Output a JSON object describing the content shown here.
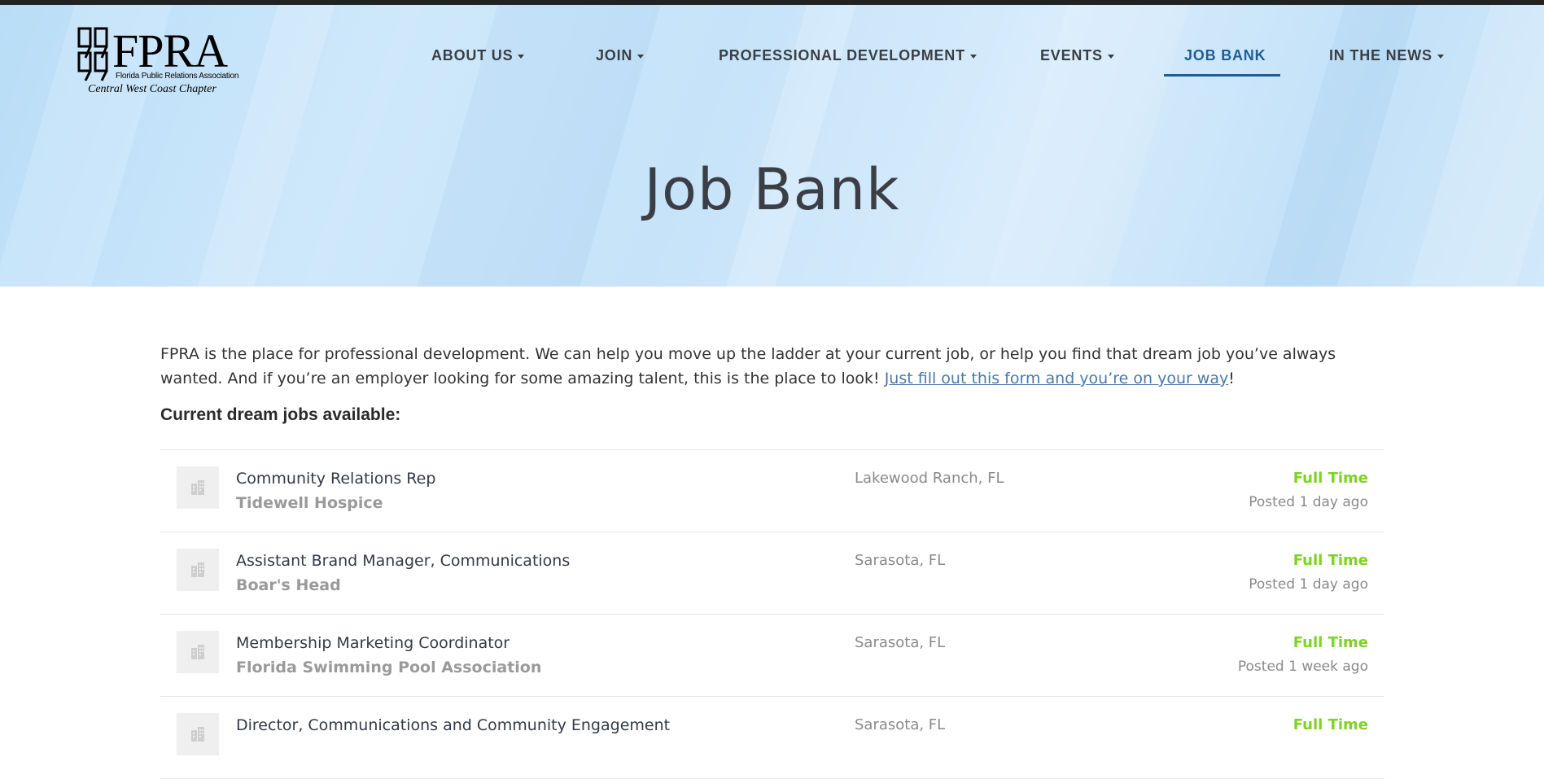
{
  "colors": {
    "accent": "#1c5e96",
    "link": "#4a79a8",
    "full_time": "#7ed321",
    "hero_bg": "#c8e4f9"
  },
  "logo": {
    "name": "FPRA",
    "tagline": "Florida Public Relations Association",
    "chapter": "Central West Coast Chapter"
  },
  "nav": {
    "items": [
      {
        "label": "ABOUT US",
        "dropdown": true
      },
      {
        "label": "JOIN",
        "dropdown": true
      },
      {
        "label": "PROFESSIONAL DEVELOPMENT",
        "dropdown": true
      },
      {
        "label": "EVENTS",
        "dropdown": true
      },
      {
        "label": "JOB BANK",
        "dropdown": false,
        "active": true
      },
      {
        "label": "IN THE NEWS",
        "dropdown": true
      }
    ]
  },
  "page": {
    "title": "Job Bank",
    "intro": "FPRA is the place for professional development. We can help you move up the ladder at your current job, or help you find that dream job you’ve always wanted. And if you’re an employer looking for some amazing talent, this is the place to look! ",
    "intro_link": "Just fill out this form and you’re on your way",
    "intro_end": "!",
    "subhead": "Current dream jobs available:"
  },
  "jobs": [
    {
      "title": "Community Relations Rep",
      "company": "Tidewell Hospice",
      "location": "Lakewood Ranch, FL",
      "type": "Full Time",
      "posted": "Posted 1 day ago"
    },
    {
      "title": "Assistant Brand Manager, Communications",
      "company": "Boar's Head",
      "location": "Sarasota, FL",
      "type": "Full Time",
      "posted": "Posted 1 day ago"
    },
    {
      "title": "Membership Marketing Coordinator",
      "company": "Florida Swimming Pool Association",
      "location": "Sarasota, FL",
      "type": "Full Time",
      "posted": "Posted 1 week ago"
    },
    {
      "title": "Director, Communications and Community Engagement",
      "company": "",
      "location": "Sarasota, FL",
      "type": "Full Time",
      "posted": ""
    }
  ]
}
